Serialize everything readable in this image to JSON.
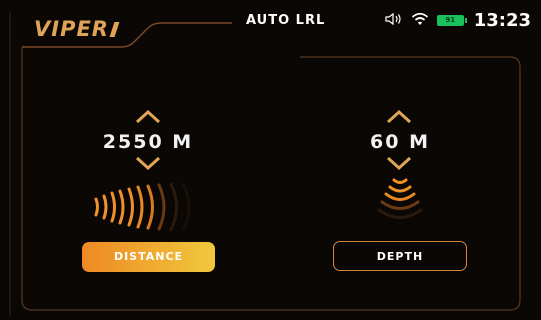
{
  "header": {
    "logo_text": "VIPER",
    "mode_title": "AUTO LRL",
    "clock": "13:23",
    "battery_level": "91",
    "icons": [
      "speaker-icon",
      "wifi-icon",
      "battery-icon"
    ]
  },
  "distance": {
    "value": "2550 M",
    "button_label": "DISTANCE",
    "increase_icon": "chevron-up-icon",
    "decrease_icon": "chevron-down-icon"
  },
  "depth": {
    "value": "60 M",
    "button_label": "DEPTH",
    "increase_icon": "chevron-up-icon",
    "decrease_icon": "chevron-down-icon"
  },
  "colors": {
    "accent_orange": "#e0a458",
    "frame_line": "#7a4a2a",
    "active_gradient_start": "#ee8a24",
    "active_gradient_end": "#f0c83c",
    "battery_green": "#18c25a"
  }
}
